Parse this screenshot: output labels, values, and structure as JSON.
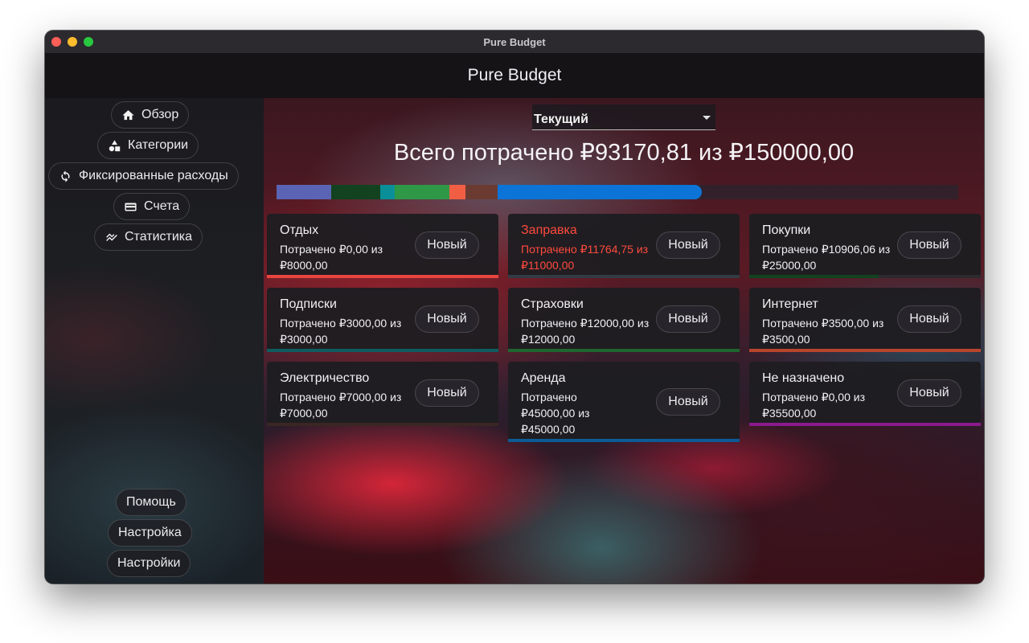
{
  "window": {
    "title": "Pure Budget"
  },
  "app": {
    "title": "Pure Budget"
  },
  "sidebar": {
    "nav": [
      {
        "label": "Обзор",
        "icon": "home-icon"
      },
      {
        "label": "Категории",
        "icon": "categories-icon"
      },
      {
        "label": "Фиксированные расходы",
        "icon": "refresh-icon"
      },
      {
        "label": "Счета",
        "icon": "wallet-icon"
      },
      {
        "label": "Статистика",
        "icon": "chart-icon"
      }
    ],
    "bottom": [
      {
        "label": "Помощь"
      },
      {
        "label": "Настройка"
      },
      {
        "label": "Настройки"
      }
    ]
  },
  "period_select": {
    "value": "Текущий"
  },
  "summary": {
    "total_text": "Всего потрачено ₽93170,81 из ₽150000,00"
  },
  "budget_bar": {
    "segments": [
      {
        "share": 0.08,
        "color": "#5b64b4"
      },
      {
        "share": 0.072,
        "color": "#12421f"
      },
      {
        "share": 0.021,
        "color": "#0a8f98"
      },
      {
        "share": 0.081,
        "color": "#2e9847"
      },
      {
        "share": 0.023,
        "color": "#f05f44"
      },
      {
        "share": 0.047,
        "color": "#6b3b32"
      },
      {
        "share": 0.3,
        "color": "#0b74d6"
      }
    ]
  },
  "categories": [
    {
      "name": "Отдых",
      "spent_text": "Потрачено ₽0,00 из ₽8000,00",
      "button": "Новый",
      "progress": 1.0,
      "color": "#e8453f",
      "alert": false
    },
    {
      "name": "Заправка",
      "spent_text": "Потрачено ₽11764,75 из ₽11000,00",
      "button": "Новый",
      "progress": 1.0,
      "color": "#333b44",
      "alert": true
    },
    {
      "name": "Покупки",
      "spent_text": "Потрачено ₽10906,06 из ₽25000,00",
      "button": "Новый",
      "progress": 0.56,
      "color": "#12421f",
      "alert": false
    },
    {
      "name": "Подписки",
      "spent_text": "Потрачено ₽3000,00 из ₽3000,00",
      "button": "Новый",
      "progress": 1.0,
      "color": "#0f5c60",
      "alert": false
    },
    {
      "name": "Страховки",
      "spent_text": "Потрачено ₽12000,00 из ₽12000,00",
      "button": "Новый",
      "progress": 1.0,
      "color": "#1f6630",
      "alert": false
    },
    {
      "name": "Интернет",
      "spent_text": "Потрачено ₽3500,00 из ₽3500,00",
      "button": "Новый",
      "progress": 1.0,
      "color": "#b8452c",
      "alert": false
    },
    {
      "name": "Электричество",
      "spent_text": "Потрачено ₽7000,00 из ₽7000,00",
      "button": "Новый",
      "progress": 1.0,
      "color": "#3a2622",
      "alert": false
    },
    {
      "name": "Аренда",
      "spent_text": "Потрачено ₽45000,00 из ₽45000,00",
      "button": "Новый",
      "progress": 1.0,
      "color": "#0c5a96",
      "alert": false
    },
    {
      "name": "Не назначено",
      "spent_text": "Потрачено ₽0,00 из ₽35500,00",
      "button": "Новый",
      "progress": 1.0,
      "color": "#8b1a8e",
      "alert": false
    }
  ]
}
